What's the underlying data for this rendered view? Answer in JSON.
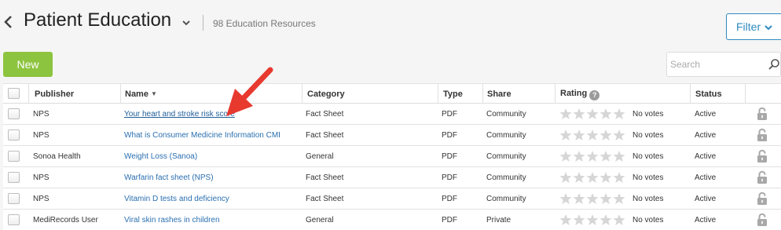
{
  "header": {
    "title": "Patient Education",
    "resource_count": "98 Education Resources",
    "filter_label": "Filter"
  },
  "toolbar": {
    "new_label": "New",
    "search_placeholder": "Search"
  },
  "colors": {
    "accent_blue": "#2e8bc0",
    "new_green": "#8dc43f",
    "link_blue": "#2a6fb0",
    "annotation_red": "#e8392f"
  },
  "icons": [
    "chevron-left-icon",
    "chevron-down-icon",
    "search-icon",
    "star-icon",
    "help-icon",
    "lock-icon",
    "annotation-arrow"
  ],
  "table": {
    "columns": {
      "publisher": "Publisher",
      "name": "Name",
      "category": "Category",
      "type": "Type",
      "share": "Share",
      "rating": "Rating",
      "status": "Status"
    },
    "sort_indicator": "▼",
    "help_symbol": "?",
    "rows": [
      {
        "publisher": "NPS",
        "name": "Your heart and stroke risk score",
        "category": "Fact Sheet",
        "type": "PDF",
        "share": "Community",
        "rating_stars": 0,
        "votes": "No votes",
        "status": "Active"
      },
      {
        "publisher": "NPS",
        "name": "What is Consumer Medicine Information CMI",
        "category": "Fact Sheet",
        "type": "PDF",
        "share": "Community",
        "rating_stars": 0,
        "votes": "No votes",
        "status": "Active"
      },
      {
        "publisher": "Sonoa Health",
        "name": "Weight Loss (Sanoa)",
        "category": "General",
        "type": "PDF",
        "share": "Community",
        "rating_stars": 0,
        "votes": "No votes",
        "status": "Active"
      },
      {
        "publisher": "NPS",
        "name": "Warfarin fact sheet (NPS)",
        "category": "Fact Sheet",
        "type": "PDF",
        "share": "Community",
        "rating_stars": 0,
        "votes": "No votes",
        "status": "Active"
      },
      {
        "publisher": "NPS",
        "name": "Vitamin D tests and deficiency",
        "category": "Fact Sheet",
        "type": "PDF",
        "share": "Community",
        "rating_stars": 0,
        "votes": "No votes",
        "status": "Active"
      },
      {
        "publisher": "MediRecords User",
        "name": "Viral skin rashes in children",
        "category": "General",
        "type": "PDF",
        "share": "Private",
        "rating_stars": 0,
        "votes": "No votes",
        "status": "Active"
      }
    ]
  }
}
